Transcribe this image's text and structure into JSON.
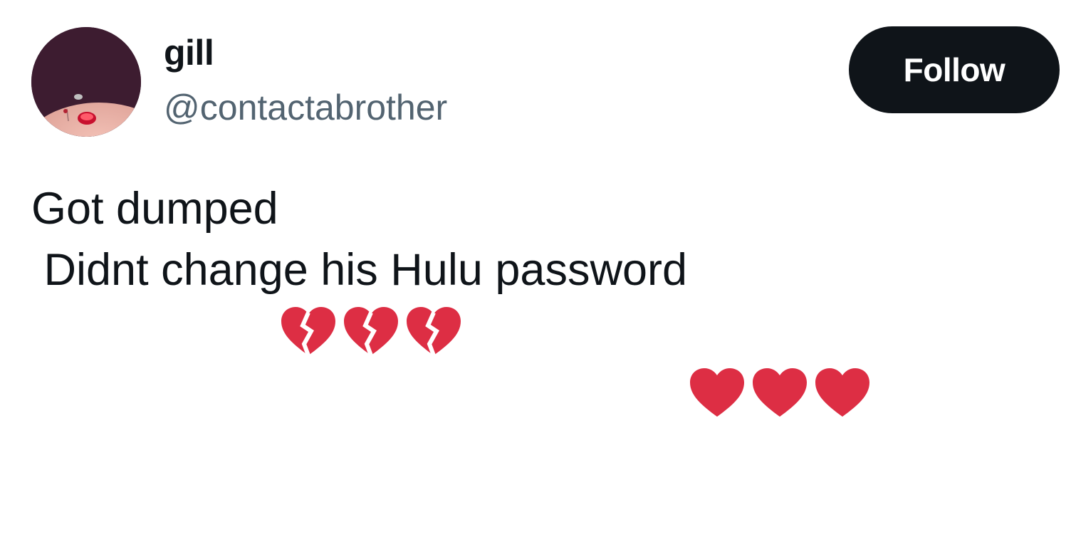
{
  "author": {
    "display_name": "gill",
    "handle": "@contactabrother",
    "avatar_description": "avatar"
  },
  "follow_button": {
    "label": "Follow"
  },
  "tweet": {
    "line1_text": "Got dumped",
    "line1_emojis": [
      "broken-heart",
      "broken-heart",
      "broken-heart"
    ],
    "line2_text": " Didnt change his Hulu password",
    "line2_emojis": [
      "red-heart",
      "red-heart",
      "red-heart"
    ]
  },
  "colors": {
    "text_primary": "#0f1419",
    "text_secondary": "#536471",
    "button_bg": "#0f1419",
    "button_text": "#ffffff",
    "heart_red": "#dd2e44"
  }
}
